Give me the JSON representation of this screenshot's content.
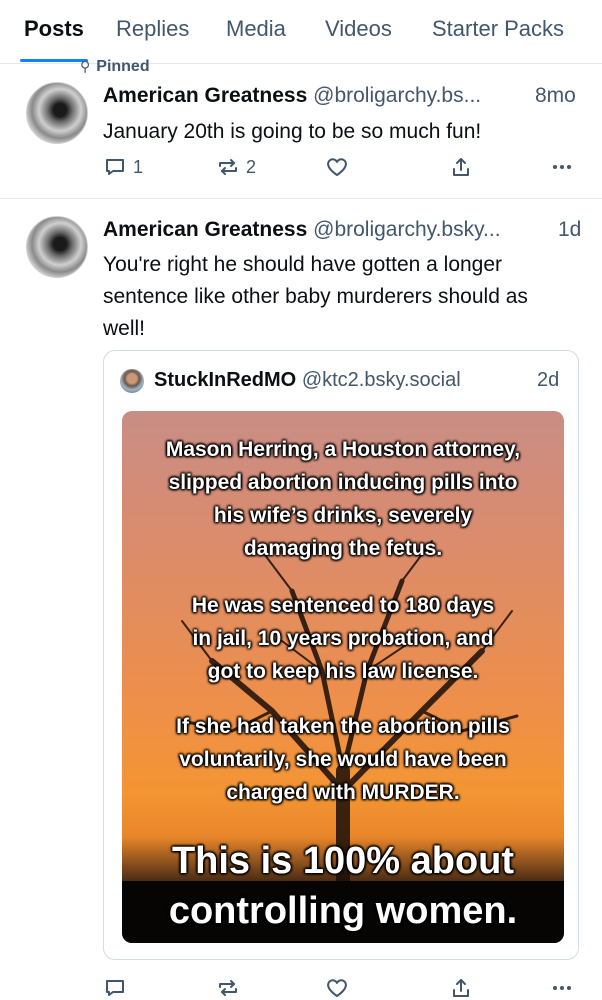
{
  "tabs": [
    {
      "label": "Posts",
      "active": true
    },
    {
      "label": "Replies",
      "active": false
    },
    {
      "label": "Media",
      "active": false
    },
    {
      "label": "Videos",
      "active": false
    },
    {
      "label": "Starter Packs",
      "active": false
    }
  ],
  "pinned_label": "Pinned",
  "posts": [
    {
      "author_name": "American Greatness",
      "author_handle": "@broligarchy.bs...",
      "time": "8mo",
      "text": "January 20th is going to be so much fun!",
      "reply_count": "1",
      "repost_count": "2"
    },
    {
      "author_name": "American Greatness",
      "author_handle": "@broligarchy.bsky...",
      "time": "1d",
      "text": "You're right he should have gotten a longer sentence like other baby murderers should as well!",
      "quote": {
        "author_name": "StuckInRedMO",
        "author_handle": "@ktc2.bsky.social",
        "time": "2d",
        "image_text": {
          "p1": [
            "Mason Herring, a Houston attorney,",
            "slipped abortion inducing pills into",
            "his wife’s drinks, severely",
            "damaging the fetus."
          ],
          "p2": [
            "He was sentenced to 180 days",
            "in jail, 10 years probation, and",
            "got to keep his law license."
          ],
          "p3": [
            "If she had taken the abortion pills",
            "voluntarily, she would have been",
            "charged with MURDER."
          ],
          "p4": [
            "This is 100% about",
            "controlling women."
          ]
        }
      }
    }
  ],
  "icons": {
    "reply": "speech-bubble-icon",
    "repost": "repost-arrows-icon",
    "like": "heart-icon",
    "share": "share-upload-icon",
    "more": "ellipsis-icon",
    "pin": "pin-icon"
  },
  "colors": {
    "accent": "#1083fe",
    "text": "#0b0f14",
    "muted": "#42576c",
    "divider": "#e6e9ec"
  }
}
